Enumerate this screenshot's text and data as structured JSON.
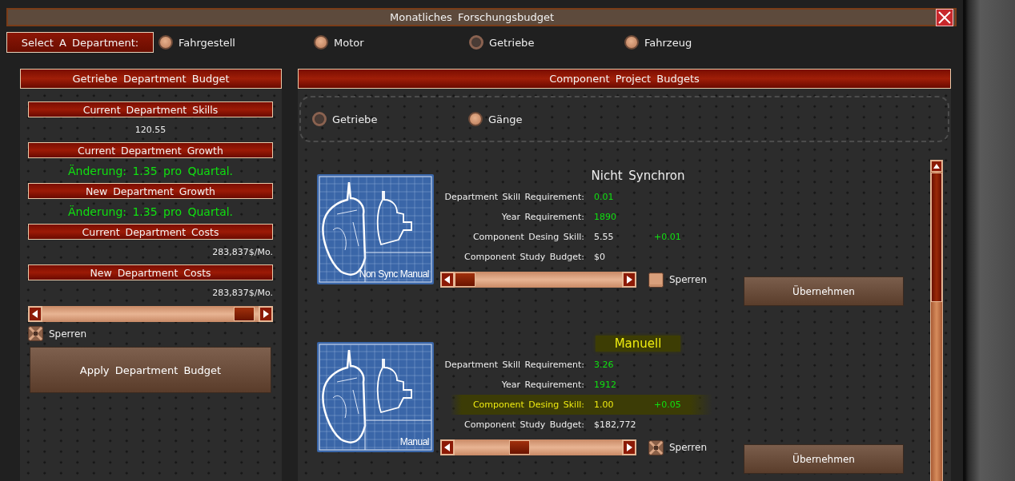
{
  "window": {
    "title": "Monatliches Forschungsbudget"
  },
  "department_selector": {
    "label": "Select A Department:",
    "options": [
      {
        "label": "Fahrgestell",
        "selected": false
      },
      {
        "label": "Motor",
        "selected": false
      },
      {
        "label": "Getriebe",
        "selected": true
      },
      {
        "label": "Fahrzeug",
        "selected": false
      }
    ]
  },
  "department_budget": {
    "title": "Getriebe Department Budget",
    "sections": [
      {
        "heading": "Current Department Skills",
        "value": "120.55",
        "kind": "number"
      },
      {
        "heading": "Current Department Growth",
        "value": "Änderung: 1.35 pro Quartal.",
        "kind": "growth"
      },
      {
        "heading": "New Department Growth",
        "value": "Änderung: 1.35 pro Quartal.",
        "kind": "growth"
      },
      {
        "heading": "Current Department Costs",
        "value": "283,837$/Mo.",
        "kind": "cost"
      },
      {
        "heading": "New Department Costs",
        "value": "283,837$/Mo.",
        "kind": "cost"
      }
    ],
    "slider": {
      "level": 0.98
    },
    "lock": {
      "label": "Sperren",
      "checked": true
    },
    "apply_button": "Apply Department Budget"
  },
  "component_projects": {
    "title": "Component Project Budgets",
    "types": [
      {
        "label": "Getriebe",
        "selected": true
      },
      {
        "label": "Gänge",
        "selected": false
      }
    ],
    "components": [
      {
        "name": "Nicht Synchron",
        "image_caption": "Non Sync Manual",
        "highlighted": false,
        "stats": [
          {
            "label": "Department Skill Requirement:",
            "value": "0.01",
            "kind": "requirement",
            "highlighted": false
          },
          {
            "label": "Year Requirement:",
            "value": "1890",
            "kind": "requirement",
            "highlighted": false
          },
          {
            "label": "Component Desing Skill:",
            "value": "5.55",
            "delta": "+0.01",
            "kind": "plain",
            "highlighted": false
          },
          {
            "label": "Component Study Budget:",
            "value": "$0",
            "kind": "plain",
            "highlighted": false
          }
        ],
        "slider": {
          "level": 0
        },
        "lock": {
          "label": "Sperren",
          "checked": false
        },
        "apply_button": "Übernehmen"
      },
      {
        "name": "Manuell",
        "image_caption": "Manual",
        "highlighted": true,
        "stats": [
          {
            "label": "Department Skill Requirement:",
            "value": "3.26",
            "kind": "requirement",
            "highlighted": false
          },
          {
            "label": "Year Requirement:",
            "value": "1912",
            "kind": "requirement",
            "highlighted": false
          },
          {
            "label": "Component Desing Skill:",
            "value": "1.00",
            "delta": "+0.05",
            "kind": "plain",
            "highlighted": true
          },
          {
            "label": "Component Study Budget:",
            "value": "$182,772",
            "kind": "plain",
            "highlighted": false
          }
        ],
        "slider": {
          "level": 0.37
        },
        "lock": {
          "label": "Sperren",
          "checked": true
        },
        "apply_button": "Übernehmen"
      }
    ]
  }
}
